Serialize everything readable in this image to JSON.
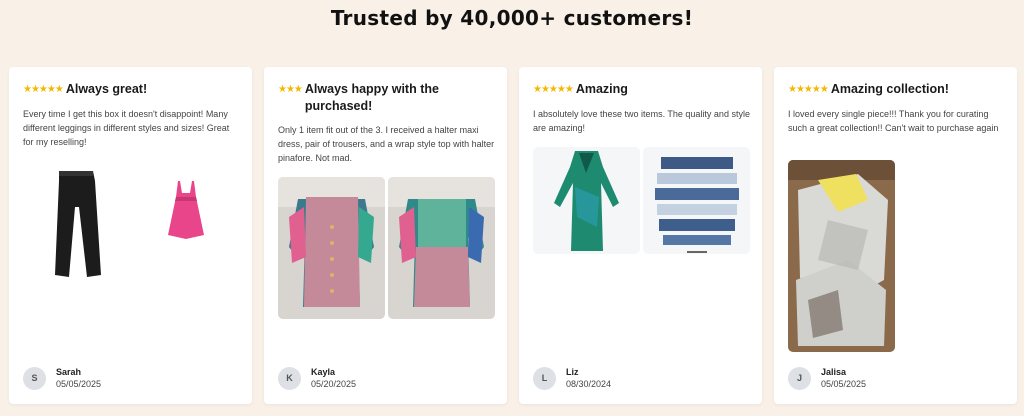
{
  "heading": "Trusted by 40,000+ customers!",
  "reviews": [
    {
      "stars": "★★★★★",
      "title": "Always great!",
      "body": "Every time I get this box it doesn't disappoint! Many different leggings in different styles and sizes! Great for my reselling!",
      "initial": "S",
      "name": "Sarah",
      "date": "05/05/2025"
    },
    {
      "stars": "★★★",
      "title": "Always happy with the purchased!",
      "body": "Only 1 item fit out of the 3. I received a halter maxi dress, pair of trousers, and a wrap style top with halter pinafore. Not mad.",
      "initial": "K",
      "name": "Kayla",
      "date": "05/20/2025"
    },
    {
      "stars": "★★★★★",
      "title": "Amazing",
      "body": "I absolutely love these two items. The quality and style are amazing!",
      "initial": "L",
      "name": "Liz",
      "date": "08/30/2024"
    },
    {
      "stars": "★★★★★",
      "title": "Amazing collection!",
      "body": "I loved every single piece!!! Thank you for curating such a great collection!! Can't wait to purchase again",
      "initial": "J",
      "name": "Jalisa",
      "date": "05/05/2025"
    }
  ]
}
